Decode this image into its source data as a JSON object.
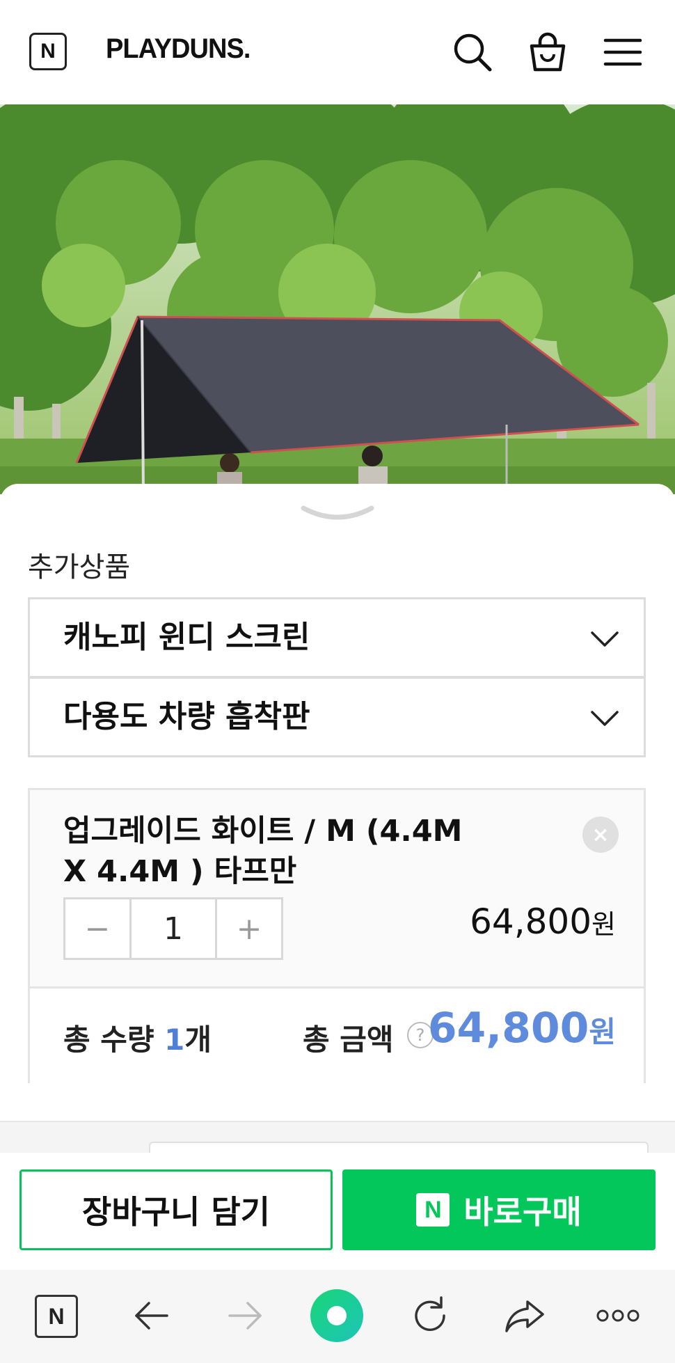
{
  "header": {
    "logo_letter": "N",
    "brand": "PLAYDUNS."
  },
  "icons": {
    "search": "search-icon",
    "cart": "shopping-bag-icon",
    "menu": "hamburger-menu-icon"
  },
  "options_sheet": {
    "section_title": "추가상품",
    "selects": [
      {
        "label": "캐노피 윈디 스크린"
      },
      {
        "label": "다용도 차량 흡착판"
      }
    ],
    "selected_item": {
      "name": "업그레이드 화이트 / M (4.4M X 4.4M ) 타프만",
      "quantity": "1",
      "minus": "−",
      "plus": "+",
      "price": "64,800",
      "currency": "원",
      "remove": "×"
    },
    "totals": {
      "quantity_prefix": "총 수량 ",
      "quantity_value": "1",
      "quantity_suffix": "개",
      "amount_label": "총 금액",
      "help": "?",
      "amount_value": "64,800",
      "amount_currency": "원"
    }
  },
  "actions": {
    "cart_button": "장바구니 담기",
    "buy_button": "바로구매",
    "buy_logo": "N"
  },
  "browser_bar": {
    "home_logo": "N"
  },
  "colors": {
    "naver_green": "#03c75a",
    "price_blue": "#5f8bdc"
  }
}
